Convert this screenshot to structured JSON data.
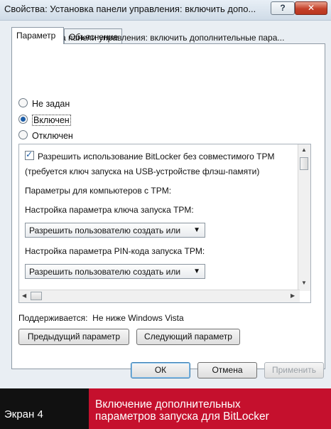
{
  "window": {
    "title": "Свойства: Установка панели управления: включить допо...",
    "help_label": "?",
    "close_label": "✕"
  },
  "tabs": [
    {
      "label": "Параметр"
    },
    {
      "label": "Объяснение"
    }
  ],
  "policy": {
    "name": "Установка панели управления: включить дополнительные пара..."
  },
  "radios": [
    {
      "label": "Не задан",
      "checked": false
    },
    {
      "label": "Включен",
      "checked": true
    },
    {
      "label": "Отключен",
      "checked": false
    }
  ],
  "options": {
    "allow_without_tpm": "Разрешить использование BitLocker без совместимого TPM",
    "requires_key": "(требуется ключ запуска на USB-устройстве флэш-памяти)",
    "tpm_params_label": "Параметры для компьютеров с TPM:",
    "startup_key_label": "Настройка параметра ключа запуска TPM:",
    "startup_key_value": "Разрешить пользователю создать или",
    "pin_label": "Настройка параметра PIN-кода запуска TPM:",
    "pin_value": "Разрешить пользователю создать или"
  },
  "supported": {
    "label": "Поддерживается:",
    "value": "Не ниже Windows Vista"
  },
  "buttons": {
    "prev": "Предыдущий параметр",
    "next": "Следующий параметр",
    "ok": "ОК",
    "cancel": "Отмена",
    "apply": "Применить"
  },
  "caption": {
    "left": "Экран 4",
    "right_line1": "Включение дополнительных",
    "right_line2": "параметров запуска для BitLocker"
  }
}
